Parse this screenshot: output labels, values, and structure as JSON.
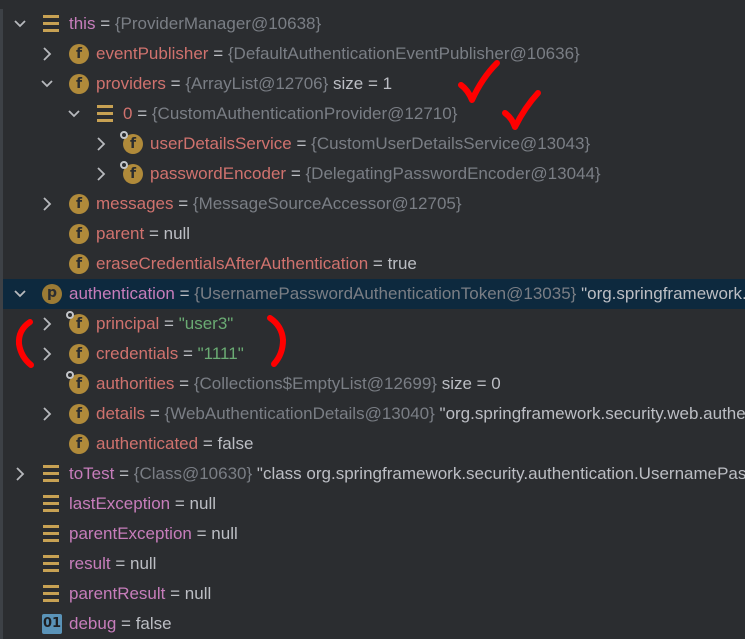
{
  "colors": {
    "background": "#2b2d30",
    "selected_row": "#0d293e",
    "name": "#c77dbb",
    "object": "#7a7e85",
    "string": "#6aab73",
    "plain": "#bcbec4",
    "field_icon": "#b08a3a",
    "annotation": "#ff0000"
  },
  "rows": [
    {
      "depth": 0,
      "arrow": "expanded",
      "icon": "variable",
      "name": "this",
      "obj": "{ProviderManager@10638}"
    },
    {
      "depth": 1,
      "arrow": "collapsed",
      "icon": "field",
      "name": "eventPublisher",
      "obj": "{DefaultAuthenticationEventPublisher@10636}"
    },
    {
      "depth": 1,
      "arrow": "expanded",
      "icon": "field",
      "name": "providers",
      "obj": "{ArrayList@12706}",
      "extra": "size = 1"
    },
    {
      "depth": 2,
      "arrow": "expanded",
      "icon": "variable",
      "name": "0",
      "obj": "{CustomAuthenticationProvider@12710}"
    },
    {
      "depth": 3,
      "arrow": "collapsed",
      "icon": "field-locked",
      "name": "userDetailsService",
      "obj": "{CustomUserDetailsService@13043}"
    },
    {
      "depth": 3,
      "arrow": "collapsed",
      "icon": "field-locked",
      "name": "passwordEncoder",
      "obj": "{DelegatingPasswordEncoder@13044}"
    },
    {
      "depth": 1,
      "arrow": "collapsed",
      "icon": "field",
      "name": "messages",
      "obj": "{MessageSourceAccessor@12705}"
    },
    {
      "depth": 1,
      "arrow": "none",
      "icon": "field",
      "name": "parent",
      "value": "null"
    },
    {
      "depth": 1,
      "arrow": "none",
      "icon": "field",
      "name": "eraseCredentialsAfterAuthentication",
      "value": "true"
    },
    {
      "depth": 0,
      "arrow": "expanded",
      "icon": "parameter",
      "name": "authentication",
      "obj": "{UsernamePasswordAuthenticationToken@13035}",
      "value": "\"org.springframework.security.authentication.UsernamePasswordAuthenticationToken",
      "selected": true
    },
    {
      "depth": 1,
      "arrow": "collapsed",
      "icon": "field-locked",
      "name": "principal",
      "str": "\"user3\""
    },
    {
      "depth": 1,
      "arrow": "collapsed",
      "icon": "field",
      "name": "credentials",
      "str": "\"1111\""
    },
    {
      "depth": 1,
      "arrow": "none",
      "icon": "field-locked",
      "name": "authorities",
      "obj": "{Collections$EmptyList@12699}",
      "extra": "size = 0"
    },
    {
      "depth": 1,
      "arrow": "collapsed",
      "icon": "field",
      "name": "details",
      "obj": "{WebAuthenticationDetails@13040}",
      "value": "\"org.springframework.security.web.authentication.WebAuthenticationDetails"
    },
    {
      "depth": 1,
      "arrow": "none",
      "icon": "field",
      "name": "authenticated",
      "value": "false"
    },
    {
      "depth": 0,
      "arrow": "collapsed",
      "icon": "variable",
      "name": "toTest",
      "obj": "{Class@10630}",
      "value": "\"class org.springframework.security.authentication.UsernamePasswordAuthenticationToken"
    },
    {
      "depth": 0,
      "arrow": "none",
      "icon": "variable",
      "name": "lastException",
      "value": "null"
    },
    {
      "depth": 0,
      "arrow": "none",
      "icon": "variable",
      "name": "parentException",
      "value": "null"
    },
    {
      "depth": 0,
      "arrow": "none",
      "icon": "variable",
      "name": "result",
      "value": "null"
    },
    {
      "depth": 0,
      "arrow": "none",
      "icon": "variable",
      "name": "parentResult",
      "value": "null"
    },
    {
      "depth": 0,
      "arrow": "none",
      "icon": "tag",
      "name": "debug",
      "value": "false"
    }
  ],
  "equals_sign": "="
}
